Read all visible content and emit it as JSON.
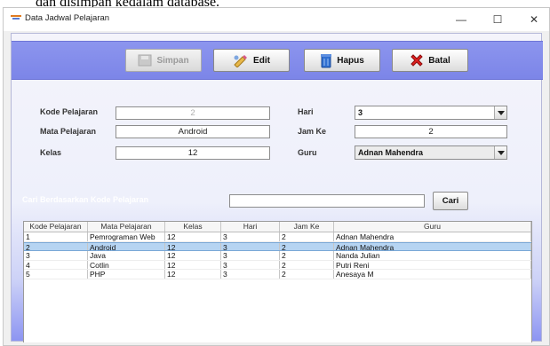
{
  "background_caption": "dan disimpan kedalam database.",
  "window": {
    "title": "Data Jadwal Pelajaran",
    "minimize_glyph": "—",
    "maximize_glyph": "☐",
    "close_glyph": "✕"
  },
  "toolbar": {
    "simpan": "Simpan",
    "edit": "Edit",
    "hapus": "Hapus",
    "batal": "Batal"
  },
  "form": {
    "kode_label": "Kode Pelajaran",
    "kode_value": "2",
    "mapel_label": "Mata Pelajaran",
    "mapel_value": "Android",
    "kelas_label": "Kelas",
    "kelas_value": "12",
    "hari_label": "Hari",
    "hari_value": "3",
    "jamke_label": "Jam Ke",
    "jamke_value": "2",
    "guru_label": "Guru",
    "guru_value": "Adnan Mahendra"
  },
  "search": {
    "label": "Cari Berdasarkan Kode Pelajaran",
    "value": "",
    "button": "Cari"
  },
  "table": {
    "headers": [
      "Kode Pelajaran",
      "Mata Pelajaran",
      "Kelas",
      "Hari",
      "Jam Ke",
      "Guru"
    ],
    "rows": [
      [
        "1",
        "Pemrograman Web",
        "12",
        "3",
        "2",
        "Adnan Mahendra"
      ],
      [
        "2",
        "Android",
        "12",
        "3",
        "2",
        "Adnan Mahendra"
      ],
      [
        "3",
        "Java",
        "12",
        "3",
        "2",
        "Nanda Julian"
      ],
      [
        "4",
        "Cotlin",
        "12",
        "3",
        "2",
        "Putri Reni"
      ],
      [
        "5",
        "PHP",
        "12",
        "3",
        "2",
        "Anesaya M"
      ]
    ],
    "selected_row": 1
  },
  "colors": {
    "toolbar": "#8c95ee",
    "selection": "#b6d4f2",
    "gradient_bottom": "#8d95f2"
  }
}
